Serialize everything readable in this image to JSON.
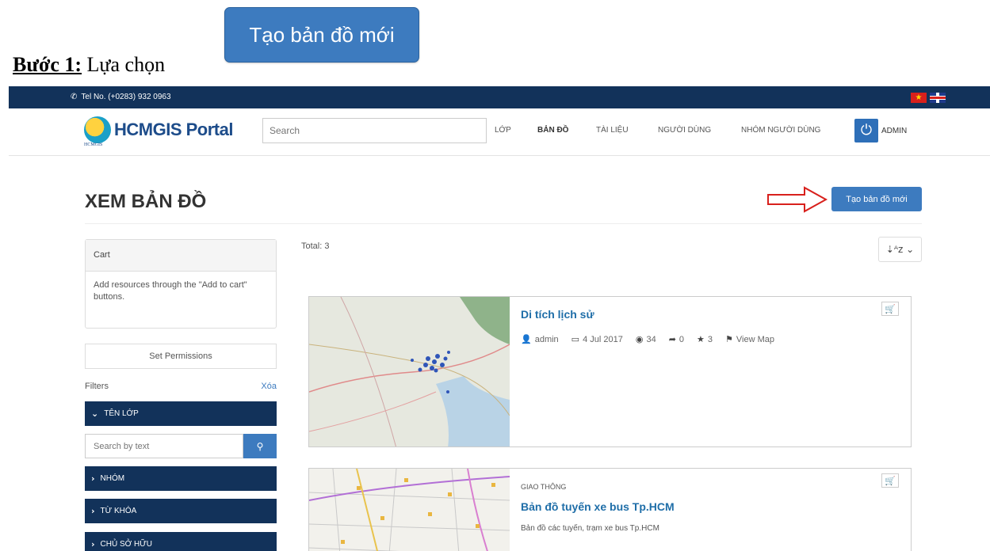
{
  "step": {
    "label": "Bước 1:",
    "text": "Lựa chọn",
    "button": "Tạo bản đồ mới"
  },
  "topbar": {
    "tel": "Tel No. (+0283) 932 0963"
  },
  "brand": {
    "name": "HCMGIS Portal",
    "sub": "HCMGIS"
  },
  "search": {
    "placeholder": "Search"
  },
  "nav": [
    "LỚP",
    "BẢN ĐỒ",
    "TÀI LIỆU",
    "NGƯỜI DÙNG",
    "NHÓM NGƯỜI DÙNG"
  ],
  "user": "ADMIN",
  "page": {
    "title": "XEM BẢN ĐỒ",
    "new_map": "Tạo bản đồ mới"
  },
  "cart": {
    "title": "Cart",
    "body": "Add resources through the \"Add to cart\" buttons."
  },
  "permissions": "Set Permissions",
  "filters": {
    "label": "Filters",
    "clear": "Xóa"
  },
  "facets": [
    "TÊN LỚP",
    "NHÓM",
    "TỪ KHÓA",
    "CHỦ SỞ HỮU"
  ],
  "text_search": {
    "placeholder": "Search by text"
  },
  "results": {
    "total": "Total: 3"
  },
  "cards": [
    {
      "title": "Di tích lịch sử",
      "owner": "admin",
      "date": "4 Jul 2017",
      "views": "34",
      "shares": "0",
      "rating": "3",
      "view_map": "View Map"
    },
    {
      "category": "GIAO THÔNG",
      "title": "Bản đồ tuyến xe bus Tp.HCM",
      "description": "Bản đồ các tuyến, trạm xe bus Tp.HCM"
    }
  ],
  "colors": {
    "navy": "#12325a",
    "accent": "#3d7bbf",
    "link": "#1f6ea8",
    "arrow": "#d8201c"
  },
  "icons": {
    "sort": "sort-alpha-icon",
    "cart": "shopping-cart-icon",
    "power": "power-icon"
  }
}
